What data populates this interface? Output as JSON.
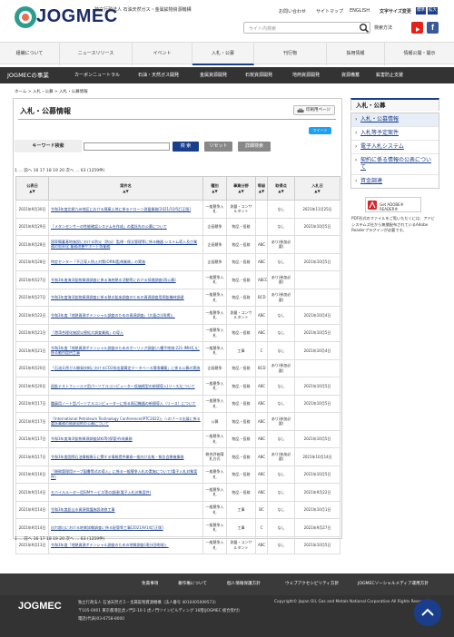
{
  "header": {
    "logo_text": "JOGMEC",
    "org_name": "独立行政法人 石油天然ガス・金属鉱物資源機構",
    "utility": [
      "お問い合わせ",
      "サイトマップ",
      "ENGLISH"
    ],
    "font_size_label": "文字サイズ変更",
    "font_size_options": [
      "標準",
      "拡大"
    ],
    "search_placeholder": "サイト内検索",
    "detail_search": "検索方法"
  },
  "gnav": [
    "組織について",
    "ニュースリリース",
    "イベント",
    "入札・公募",
    "刊行物",
    "採用情報",
    "情報公開・開示"
  ],
  "bizbar": {
    "title": "JOGMECの事業",
    "items": [
      "カーボンニュートラル",
      "石油・天然ガス開発",
      "金属資源開発",
      "石炭資源開発",
      "地熱資源開発",
      "資源備蓄",
      "鉱害防止支援"
    ]
  },
  "breadcrumb": "ホーム > 入札・公募 > 入札・公募情報",
  "page": {
    "title": "入札・公募情報",
    "print_label": "印刷用ページ",
    "tweet_label": "ツイート",
    "keyword_label": "キーワード検索",
    "search_button": "検 索",
    "reset_button": "リセット",
    "detail_button": "詳細検索",
    "pager": "1 … 前へ 16 17 18 19 20 次へ … 63 (1259件)"
  },
  "table": {
    "headers": [
      "公表日",
      "案件名",
      "種別",
      "事業分野",
      "等級",
      "取得点",
      "入札日"
    ],
    "rows": [
      [
        "2021年9月30日",
        "令和3年度北極九州地区における廃棄土地に係るドローン測量業務[2021/10/5訂正版]",
        "一般競争入札",
        "測量・コンサルタント",
        "",
        "なし",
        "2021年11月25日"
      ],
      [
        "2021年9月29日",
        "「メタンセンサーの性能確認システムを作成」の委託先の公募について",
        "企画競争",
        "物品・役務",
        "",
        "なし",
        "2021年10月5日"
      ],
      [
        "2021年9月28日",
        "国家備蓄基地施設における防災（防災）監視・保全管理等に係る機器 システム導入及び業務の効率化 業務改善サポート等業務",
        "企画競争",
        "物品・役務",
        "ABC",
        "あり(参加必要)",
        ""
      ],
      [
        "2021年9月28日",
        "特定センター「不正導入防止対策(ORN)監視業務」の実施",
        "企画競争",
        "物品・役務",
        "ABC",
        "なし",
        "2021年10月5日"
      ],
      [
        "2021年9月27日",
        "令和3年度海洋鉱物資源調査に係る海底熱水活動等における採掘調査(再公募)",
        "一般競争入札",
        "物品・役務",
        "ABCD",
        "あり(参加必要)",
        ""
      ],
      [
        "2021年9月27日",
        "令和3年度海洋鉱物資源調査に係る熱水鉱床調査のための資源調査用探鉱機材調達",
        "一般競争入札",
        "物品・役務",
        "BCD",
        "あり(参加必要)",
        ""
      ],
      [
        "2021年9月22日",
        "令和3年度「地熱資源ポテンシャル調査のための資源調査」(大量点)(再掲)」",
        "一般競争入札",
        "測量・コンサルタント",
        "ABC",
        "なし",
        "2021年10月4日"
      ],
      [
        "2021年9月21日",
        "「港湾合理化施設災害拡大調査業務」の導入",
        "一般競争入札",
        "物品・役務",
        "ABC",
        "なし",
        "2021年10月5日"
      ],
      [
        "2021年9月21日",
        "令和3年度「地熱資源ポテンシャル調査のためのボーリング調査(八幡平地域-221-IMH孔)に係る動作提供工事",
        "一般競争入札",
        "工事",
        "C",
        "なし",
        "2021年10月4日"
      ],
      [
        "2021年9月20日",
        "「石油天然ガス開発技術におけるCO2排出量算定データベース環境構築」に係る公募の実施",
        "企画競争",
        "物品・役務",
        "BCD",
        "あり(参加必要)",
        ""
      ],
      [
        "2021年9月20日",
        "鉛鉱テストフィールド用パーソナルコンピューター低価格型の新規導入(リース)について",
        "一般競争入札",
        "物品・役務",
        "ABC",
        "なし",
        "2021年10月5日"
      ],
      [
        "2021年9月17日",
        "職員用ノート型パーソナルコンピューターに係る周辺機器の新規導入（リース）について",
        "一般競争入札",
        "物品・役務",
        "ABC",
        "なし",
        "2021年10月5日"
      ],
      [
        "2021年9月17日",
        "「International Petroleum Technology Conference(IPTC2022)」へのブース出展に係る委託業務の随意契約の公募について",
        "公募",
        "物品・役務",
        "ABC",
        "あり(参加必要)",
        ""
      ],
      [
        "2021年9月17日",
        "令和3年度海洋鉱物資源調査試料等(保管)作成業務",
        "一般競争入札",
        "物品・役務",
        "ABC",
        "なし",
        "2021年10月5日"
      ],
      [
        "2021年9月17日",
        "令和3年度国際石油情報開示に関する情報提供業務一般向け広報・報告会開催業務",
        "総合評価落札方式",
        "物品・役務",
        "ABC",
        "あり(参加必要)",
        "2021年10月14日"
      ],
      [
        "2021年9月16日",
        "「総務管理用テープ図書等式の導入」に係る一般競争入札の実施について(電子入札対象案件)",
        "一般競争入札",
        "物品・役務",
        "ABC",
        "なし",
        "2021年10月5日"
      ],
      [
        "2021年9月14日",
        "モバイルルーター用SIMサービス等の調達(電子入札対象案件)",
        "一般競争入札",
        "物品・役務",
        "ABC",
        "なし",
        "2021年9月22日"
      ],
      [
        "2021年9月14日",
        "令和3年度鉛山水資源保護施設改修工事",
        "一般競争入札",
        "工事",
        "BC",
        "なし",
        "2021年10月1日"
      ],
      [
        "2021年9月14日",
        "自力超山における地質試験調査に係る配管等工事[2021/9/14訂正版]",
        "一般競争入札",
        "工事",
        "C",
        "なし",
        "2021年9月27日"
      ],
      [
        "2021年9月13日",
        "令和3年度「地熱資源ポテンシャル調査のための地質調査(滝分田地域)」",
        "一般競争入札",
        "測量・コンサルタント",
        "ABC",
        "なし",
        "2021年10月5日"
      ]
    ]
  },
  "sidebar": {
    "title": "入札・公募",
    "items": [
      "入札・公募情報",
      "入札等予定案件",
      "電子入札システム",
      "契約に係る情報の公表について",
      "資金調達"
    ],
    "adobe_label": "Get ADOBE® READER®",
    "adobe_text": "PDF形式のファイルをご覧いただくには、アドビシステムズ社から無償配布されているAdobe Readerプラグインが必要です。"
  },
  "footer": {
    "links": [
      "免責事項",
      "著作権について",
      "個人情報保護方針",
      "ウェブアクセシビリティ方針",
      "JOGMECソーシャルメディア運用方針"
    ],
    "logo": "JOGMEC",
    "org": "独立行政法人 石油天然ガス・金属鉱物資源機構（法人番号 4010405009573）",
    "address": "〒105-0001 東京都港区虎ノ門2-10-1 虎ノ門ツインビルディング 16階(JOGMEC 総合受付)",
    "phone": "電話(代表)03-6758-8000",
    "copyright": "Copyright© Japan Oil, Gas and Metals National Corporation All Rights Reserved."
  },
  "colors": {
    "brand": "#1a3e8c",
    "dark": "#333333"
  }
}
